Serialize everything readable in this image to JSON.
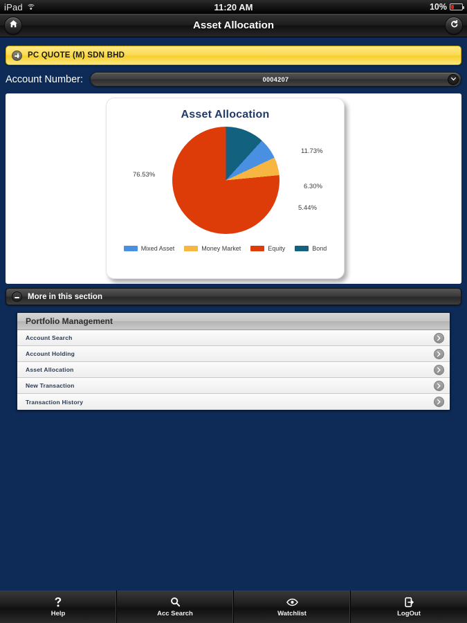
{
  "status_bar": {
    "carrier": "iPad",
    "wifi_icon": "wifi-icon",
    "time": "11:20 AM",
    "battery_percent": "10%",
    "battery_icon": "battery-icon"
  },
  "nav_bar": {
    "home_icon": "home-icon",
    "title": "Asset Allocation",
    "refresh_icon": "refresh-icon"
  },
  "company_bar": {
    "expand_icon": "plus-icon",
    "name": "PC QUOTE (M) SDN BHD"
  },
  "account": {
    "label": "Account Number:",
    "value": "0004207",
    "dropdown_icon": "chevron-down-icon"
  },
  "chart_data": {
    "type": "pie",
    "title": "Asset Allocation",
    "categories": [
      "Mixed Asset",
      "Money Market",
      "Equity",
      "Bond"
    ],
    "values": [
      6.3,
      5.44,
      76.53,
      11.73
    ],
    "labels": [
      "6.30%",
      "5.44%",
      "76.53%",
      "11.73%"
    ],
    "colors": [
      "#4a90e2",
      "#f7b542",
      "#dd3c09",
      "#12617f"
    ],
    "legend_position": "bottom",
    "unit": "%",
    "slices": [
      {
        "name": "Bond",
        "value": 11.73,
        "label": "11.73%",
        "color": "#12617f"
      },
      {
        "name": "Mixed Asset",
        "value": 6.3,
        "label": "6.30%",
        "color": "#4a90e2"
      },
      {
        "name": "Money Market",
        "value": 5.44,
        "label": "5.44%",
        "color": "#f7b542"
      },
      {
        "name": "Equity",
        "value": 76.53,
        "label": "76.53%",
        "color": "#dd3c09"
      }
    ]
  },
  "more_section": {
    "collapse_icon": "minus-icon",
    "label": "More in this section"
  },
  "portfolio_list": {
    "header": "Portfolio Management",
    "rows": [
      {
        "label": "Account Search",
        "icon": "chevron-right-icon"
      },
      {
        "label": "Account Holding",
        "icon": "chevron-right-icon"
      },
      {
        "label": "Asset Allocation",
        "icon": "chevron-right-icon"
      },
      {
        "label": "New Transaction",
        "icon": "chevron-right-icon"
      },
      {
        "label": "Transaction History",
        "icon": "chevron-right-icon"
      }
    ]
  },
  "tab_bar": {
    "tabs": [
      {
        "label": "Help",
        "icon": "question-mark-icon"
      },
      {
        "label": "Acc Search",
        "icon": "search-icon"
      },
      {
        "label": "Watchlist",
        "icon": "eye-icon"
      },
      {
        "label": "LogOut",
        "icon": "logout-icon"
      }
    ]
  },
  "theme": {
    "background": "#0d2b56",
    "accent_yellow": "#fbdc55",
    "title_navy": "#223a66"
  }
}
